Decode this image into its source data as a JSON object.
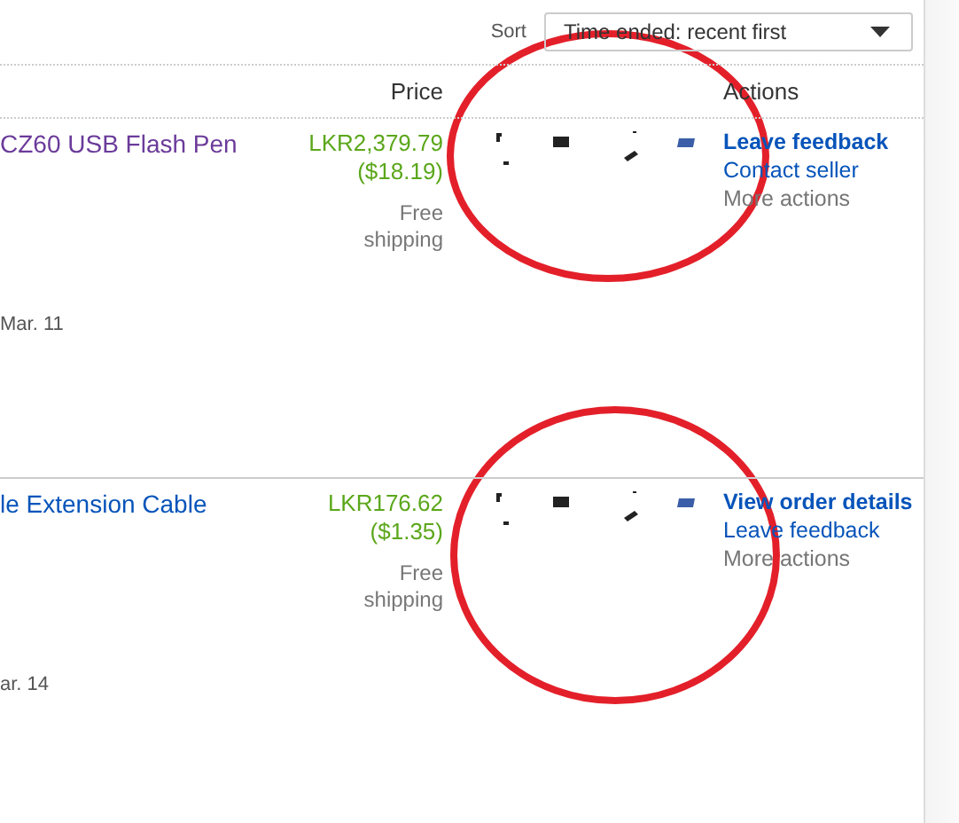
{
  "sort": {
    "label": "Sort",
    "value": "Time ended: recent first"
  },
  "columns": {
    "price": "Price",
    "actions": "Actions"
  },
  "orders": [
    {
      "title": "CZ60 USB Flash Pen",
      "visited": true,
      "price": "LKR2,379.79",
      "converted": "($18.19)",
      "shipping": "Free shipping",
      "date": "Mar. 11",
      "actions": [
        {
          "label": "Leave feedback",
          "kind": "primary"
        },
        {
          "label": "Contact seller",
          "kind": "link"
        },
        {
          "label": "More actions",
          "kind": "menu"
        }
      ]
    },
    {
      "title": "le Extension Cable",
      "visited": false,
      "price": "LKR176.62",
      "converted": "($1.35)",
      "shipping": "Free shipping",
      "date": "ar. 14",
      "actions": [
        {
          "label": "View order details",
          "kind": "primary"
        },
        {
          "label": "Leave feedback",
          "kind": "link"
        },
        {
          "label": "More actions",
          "kind": "menu"
        }
      ]
    }
  ]
}
